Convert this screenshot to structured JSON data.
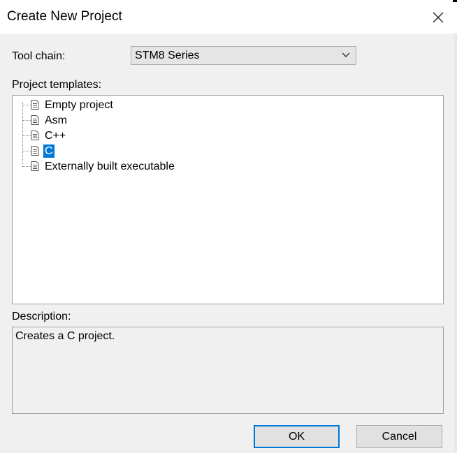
{
  "window": {
    "title": "Create New Project"
  },
  "toolchain": {
    "label": "Tool chain:",
    "selected": "STM8 Series"
  },
  "templates": {
    "label": "Project templates:",
    "items": [
      "Empty project",
      "Asm",
      "C++",
      "C",
      "Externally built executable"
    ],
    "selected_index": 3
  },
  "description": {
    "label": "Description:",
    "text": "Creates a C project."
  },
  "buttons": {
    "ok": "OK",
    "cancel": "Cancel"
  },
  "colors": {
    "selection": "#0078d7",
    "default_button_border": "#0078d7"
  },
  "icons": {
    "close": "close-icon",
    "dropdown": "chevron-down-icon",
    "template": "document-icon"
  }
}
